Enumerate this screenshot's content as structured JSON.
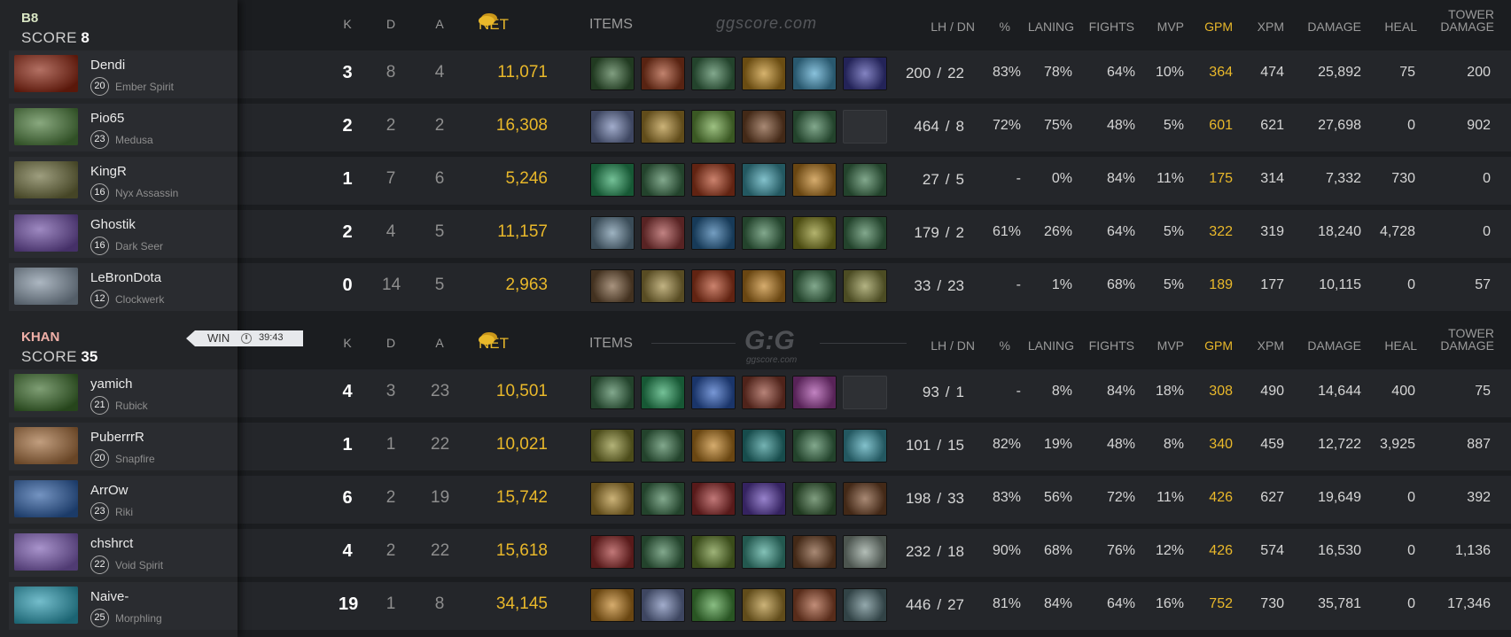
{
  "teams": [
    {
      "name": "B8",
      "score_label": "SCORE",
      "score": "8",
      "name_color": "#d9e6c4",
      "players": [
        {
          "name": "Dendi",
          "level": "20",
          "hero": "Ember Spirit",
          "portrait_color": "#8a2410",
          "k": "3",
          "d": "8",
          "a": "4",
          "net": "11,071",
          "items": [
            "#3c6a3c",
            "#a04020",
            "#3f7a50",
            "#c08a20",
            "#4aa0c8",
            "#4040a0"
          ],
          "lh": "200",
          "dn": "22",
          "pct": "83%",
          "laning": "78%",
          "fights": "64%",
          "mvp": "10%",
          "gpm": "364",
          "xpm": "474",
          "damage": "25,892",
          "heal": "75",
          "tower": "200"
        },
        {
          "name": "Pio65",
          "level": "23",
          "hero": "Medusa",
          "portrait_color": "#4a7a3a",
          "k": "2",
          "d": "2",
          "a": "2",
          "net": "16,308",
          "items": [
            "#7080b0",
            "#b08a30",
            "#6aa040",
            "#7a4a2a",
            "#3f7a50",
            null
          ],
          "lh": "464",
          "dn": "8",
          "pct": "72%",
          "laning": "75%",
          "fights": "48%",
          "mvp": "5%",
          "gpm": "601",
          "xpm": "621",
          "damage": "27,698",
          "heal": "0",
          "tower": "902"
        },
        {
          "name": "KingR",
          "level": "16",
          "hero": "Nyx Assassin",
          "portrait_color": "#6a6a3a",
          "k": "1",
          "d": "7",
          "a": "6",
          "net": "5,246",
          "items": [
            "#2aa060",
            "#3f7a50",
            "#b04020",
            "#40a0b0",
            "#c08020",
            "#3f7a50"
          ],
          "lh": "27",
          "dn": "5",
          "pct": "-",
          "laning": "0%",
          "fights": "84%",
          "mvp": "11%",
          "gpm": "175",
          "xpm": "314",
          "damage": "7,332",
          "heal": "730",
          "tower": "0"
        },
        {
          "name": "Ghostik",
          "level": "16",
          "hero": "Dark Seer",
          "portrait_color": "#6a4aa0",
          "k": "2",
          "d": "4",
          "a": "5",
          "net": "11,157",
          "items": [
            "#6a8aa0",
            "#a04040",
            "#2a6aa0",
            "#3f7a50",
            "#8a8a20",
            "#3f7a50"
          ],
          "lh": "179",
          "dn": "2",
          "pct": "61%",
          "laning": "26%",
          "fights": "64%",
          "mvp": "5%",
          "gpm": "322",
          "xpm": "319",
          "damage": "18,240",
          "heal": "4,728",
          "tower": "0"
        },
        {
          "name": "LeBronDota",
          "level": "12",
          "hero": "Clockwerk",
          "portrait_color": "#8090a0",
          "k": "0",
          "d": "14",
          "a": "5",
          "net": "2,963",
          "items": [
            "#7a5a3a",
            "#a08a40",
            "#b04020",
            "#c08020",
            "#3f7a50",
            "#8a8a40"
          ],
          "lh": "33",
          "dn": "23",
          "pct": "-",
          "laning": "1%",
          "fights": "68%",
          "mvp": "5%",
          "gpm": "189",
          "xpm": "177",
          "damage": "10,115",
          "heal": "0",
          "tower": "57"
        }
      ]
    },
    {
      "name": "KHAN",
      "score_label": "SCORE",
      "score": "35",
      "name_color": "#f0b0a8",
      "players": [
        {
          "name": "yamich",
          "level": "21",
          "hero": "Rubick",
          "portrait_color": "#3a6a2a",
          "k": "4",
          "d": "3",
          "a": "23",
          "net": "10,501",
          "items": [
            "#3f7a50",
            "#2aa060",
            "#3060c0",
            "#904030",
            "#a040a0",
            null
          ],
          "lh": "93",
          "dn": "1",
          "pct": "-",
          "laning": "8%",
          "fights": "84%",
          "mvp": "18%",
          "gpm": "308",
          "xpm": "490",
          "damage": "14,644",
          "heal": "400",
          "tower": "75"
        },
        {
          "name": "PuberrrR",
          "level": "20",
          "hero": "Snapfire",
          "portrait_color": "#a06a3a",
          "k": "1",
          "d": "1",
          "a": "22",
          "net": "10,021",
          "items": [
            "#8a8a30",
            "#3f7a50",
            "#c08020",
            "#2a8a8a",
            "#3f7a50",
            "#40a0b0"
          ],
          "lh": "101",
          "dn": "15",
          "pct": "82%",
          "laning": "19%",
          "fights": "48%",
          "mvp": "8%",
          "gpm": "340",
          "xpm": "459",
          "damage": "12,722",
          "heal": "3,925",
          "tower": "887"
        },
        {
          "name": "ArrOw",
          "level": "23",
          "hero": "Riki",
          "portrait_color": "#2a5aa0",
          "k": "6",
          "d": "2",
          "a": "19",
          "net": "15,742",
          "items": [
            "#b08a30",
            "#3f7a50",
            "#a03030",
            "#6040b0",
            "#3c6a3c",
            "#7a4a2a"
          ],
          "lh": "198",
          "dn": "33",
          "pct": "83%",
          "laning": "56%",
          "fights": "72%",
          "mvp": "11%",
          "gpm": "426",
          "xpm": "627",
          "damage": "19,649",
          "heal": "0",
          "tower": "392"
        },
        {
          "name": "chshrct",
          "level": "22",
          "hero": "Void Spirit",
          "portrait_color": "#7a5ab0",
          "k": "4",
          "d": "2",
          "a": "22",
          "net": "15,618",
          "items": [
            "#a03030",
            "#3f7a50",
            "#6a8a30",
            "#40a090",
            "#7a4a2a",
            "#8a9a90"
          ],
          "lh": "232",
          "dn": "18",
          "pct": "90%",
          "laning": "68%",
          "fights": "76%",
          "mvp": "12%",
          "gpm": "426",
          "xpm": "574",
          "damage": "16,530",
          "heal": "0",
          "tower": "1,136"
        },
        {
          "name": "Naive-",
          "level": "25",
          "hero": "Morphling",
          "portrait_color": "#2a9ab0",
          "k": "19",
          "d": "1",
          "a": "8",
          "net": "34,145",
          "items": [
            "#c08020",
            "#7080b0",
            "#4a9a40",
            "#b08a30",
            "#a05030",
            "#5a7a80"
          ],
          "lh": "446",
          "dn": "27",
          "pct": "81%",
          "laning": "84%",
          "fights": "64%",
          "mvp": "16%",
          "gpm": "752",
          "xpm": "730",
          "damage": "35,781",
          "heal": "0",
          "tower": "17,346"
        }
      ]
    }
  ],
  "headers": {
    "k": "K",
    "d": "D",
    "a": "A",
    "net": "NET",
    "items": "ITEMS",
    "lh_dn": "LH / DN",
    "pct": "%",
    "laning": "LANING",
    "fights": "FIGHTS",
    "mvp": "MVP",
    "gpm": "GPM",
    "xpm": "XPM",
    "damage": "DAMAGE",
    "heal": "HEAL",
    "tower1": "TOWER",
    "tower2": "DAMAGE"
  },
  "watermark_top": "ggscore.com",
  "watermark_logo": "G:G",
  "watermark_logo_sub": "ggscore.com",
  "result": {
    "label": "WIN",
    "duration": "39:43"
  },
  "colors": {
    "accent_gold": "#e9b82a",
    "background": "#1b1d20",
    "row": "#24262a"
  }
}
